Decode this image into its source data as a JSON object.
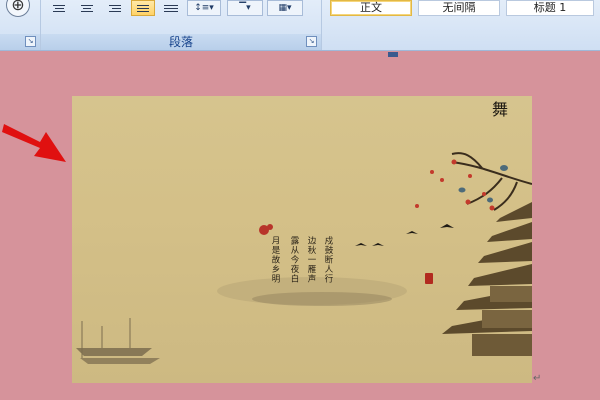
{
  "ribbon": {
    "paragraph_group_label": "段落",
    "styles": [
      {
        "label": "正文",
        "selected": true
      },
      {
        "label": "无间隔",
        "selected": false
      },
      {
        "label": "标题 1",
        "selected": false
      }
    ],
    "line_spacing_icon": "line-spacing-icon",
    "shading_icon": "shading-icon",
    "border_icon": "border-icon",
    "launcher_glyph": "↘",
    "circle_glyph": "⊕"
  },
  "document": {
    "poem_lines": [
      "戍鼓断人行",
      "边秋一雁声",
      "露从今夜白",
      "月是故乡明"
    ],
    "logo_text": "舞"
  },
  "colors": {
    "page_background": "#d6939b",
    "ribbon_accent": "#15428b",
    "arrow": "#e01010"
  }
}
